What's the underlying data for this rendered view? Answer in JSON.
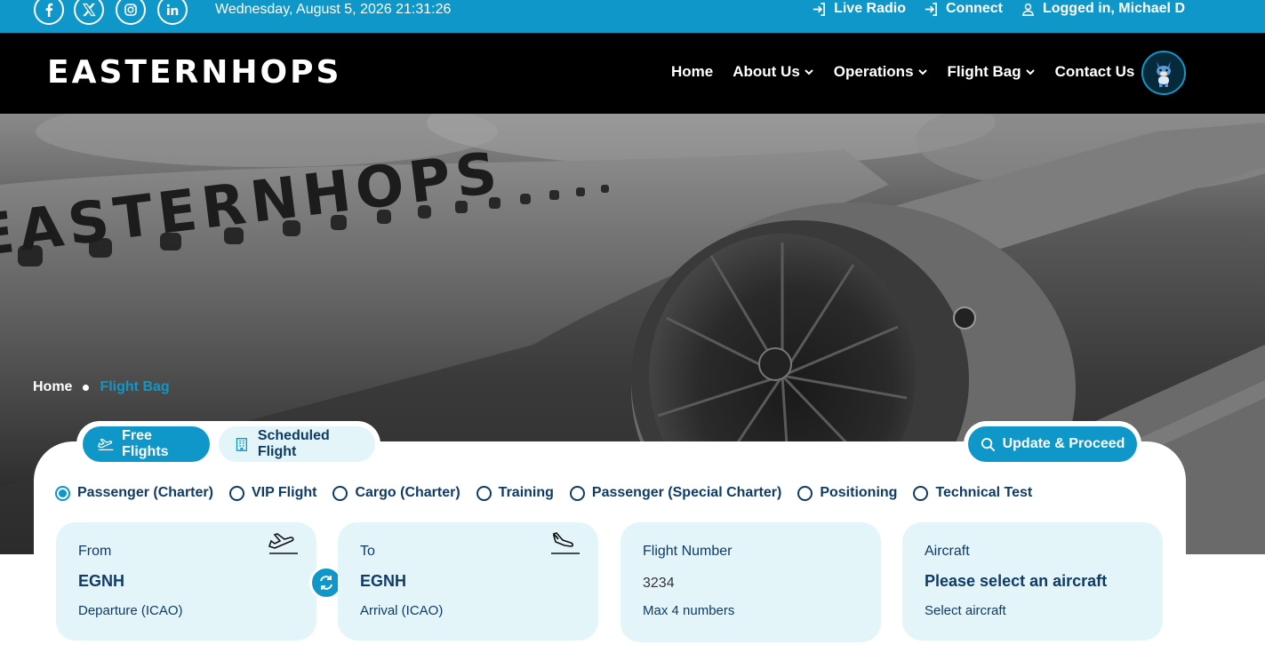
{
  "topbar": {
    "socials": [
      {
        "icon": "facebook-icon",
        "glyph": "f"
      },
      {
        "icon": "x-twitter-icon",
        "glyph": "X"
      },
      {
        "icon": "instagram-icon",
        "glyph": ""
      },
      {
        "icon": "linkedin-icon",
        "glyph": "in"
      }
    ],
    "datetime": "Wednesday, August 5, 2026 21:31:26",
    "links": {
      "live_radio": "Live Radio",
      "connect": "Connect",
      "user": "Logged in, Michael D"
    }
  },
  "nav": {
    "logo": "EASTERNHOPS",
    "items": {
      "home": "Home",
      "about": "About Us",
      "operations": "Operations",
      "flight_bag": "Flight Bag",
      "contact": "Contact Us"
    }
  },
  "hero": {
    "painted_livery": "EASTERNHOPS"
  },
  "breadcrumb": {
    "home": "Home",
    "current": "Flight Bag"
  },
  "tabs": {
    "free": "Free Flights",
    "scheduled": "Scheduled Flight"
  },
  "actions": {
    "update": "Update & Proceed"
  },
  "flight_types": {
    "selected": "Passenger (Charter)",
    "options": {
      "passenger_charter": "Passenger (Charter)",
      "vip": "VIP Flight",
      "cargo": "Cargo (Charter)",
      "training": "Training",
      "passenger_special": "Passenger (Special Charter)",
      "positioning": "Positioning",
      "technical": "Technical Test"
    }
  },
  "fields": {
    "from": {
      "label": "From",
      "value": "EGNH",
      "hint": "Departure (ICAO)"
    },
    "to": {
      "label": "To",
      "value": "EGNH",
      "hint": "Arrival (ICAO)"
    },
    "flight_number": {
      "label": "Flight Number",
      "value": "3234",
      "hint": "Max 4 numbers"
    },
    "aircraft": {
      "label": "Aircraft",
      "value": "Please select an aircraft",
      "hint": "Select aircraft"
    }
  },
  "colors": {
    "accent": "#0e97c8",
    "navy": "#0f3b66",
    "field_bg": "#e3f5f9",
    "nav_bg": "#000000"
  }
}
